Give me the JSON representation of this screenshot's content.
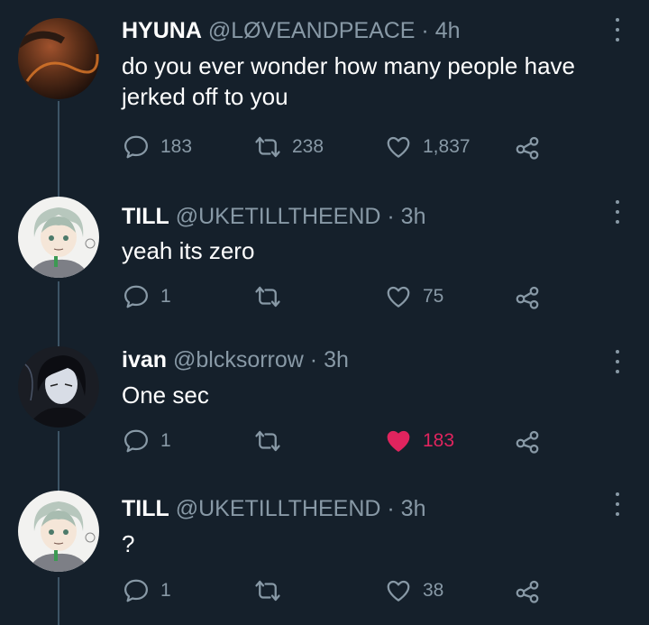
{
  "colors": {
    "background": "#15202b",
    "text_primary": "#ffffff",
    "text_secondary": "#8899a6",
    "thread_line": "#3d5466",
    "like_active": "#e0245e"
  },
  "icons": {
    "reply": "speech-bubble",
    "retweet": "retweet-arrows",
    "like": "heart-outline",
    "like_active": "heart-filled",
    "share": "share-nodes",
    "more": "vertical-ellipsis"
  },
  "tweets": [
    {
      "name": "HYUNA",
      "handle": "@LØVEANDPEACE",
      "separator": " · ",
      "time": "4h",
      "text": "do you ever wonder how many people have jerked off to you",
      "replies": "183",
      "retweets": "238",
      "likes": "1,837",
      "liked": false
    },
    {
      "name": "TILL",
      "handle": "@UKETILLTHEEND",
      "separator": " · ",
      "time": "3h",
      "text": "yeah its zero",
      "replies": "1",
      "retweets": "",
      "likes": "75",
      "liked": false
    },
    {
      "name": "ivan",
      "handle": "@blcksorrow",
      "separator": " · ",
      "time": "3h",
      "text": "One sec",
      "replies": "1",
      "retweets": "",
      "likes": "183",
      "liked": true
    },
    {
      "name": "TILL",
      "handle": "@UKETILLTHEEND",
      "separator": " · ",
      "time": "3h",
      "text": "?",
      "replies": "1",
      "retweets": "",
      "likes": "38",
      "liked": false
    }
  ]
}
